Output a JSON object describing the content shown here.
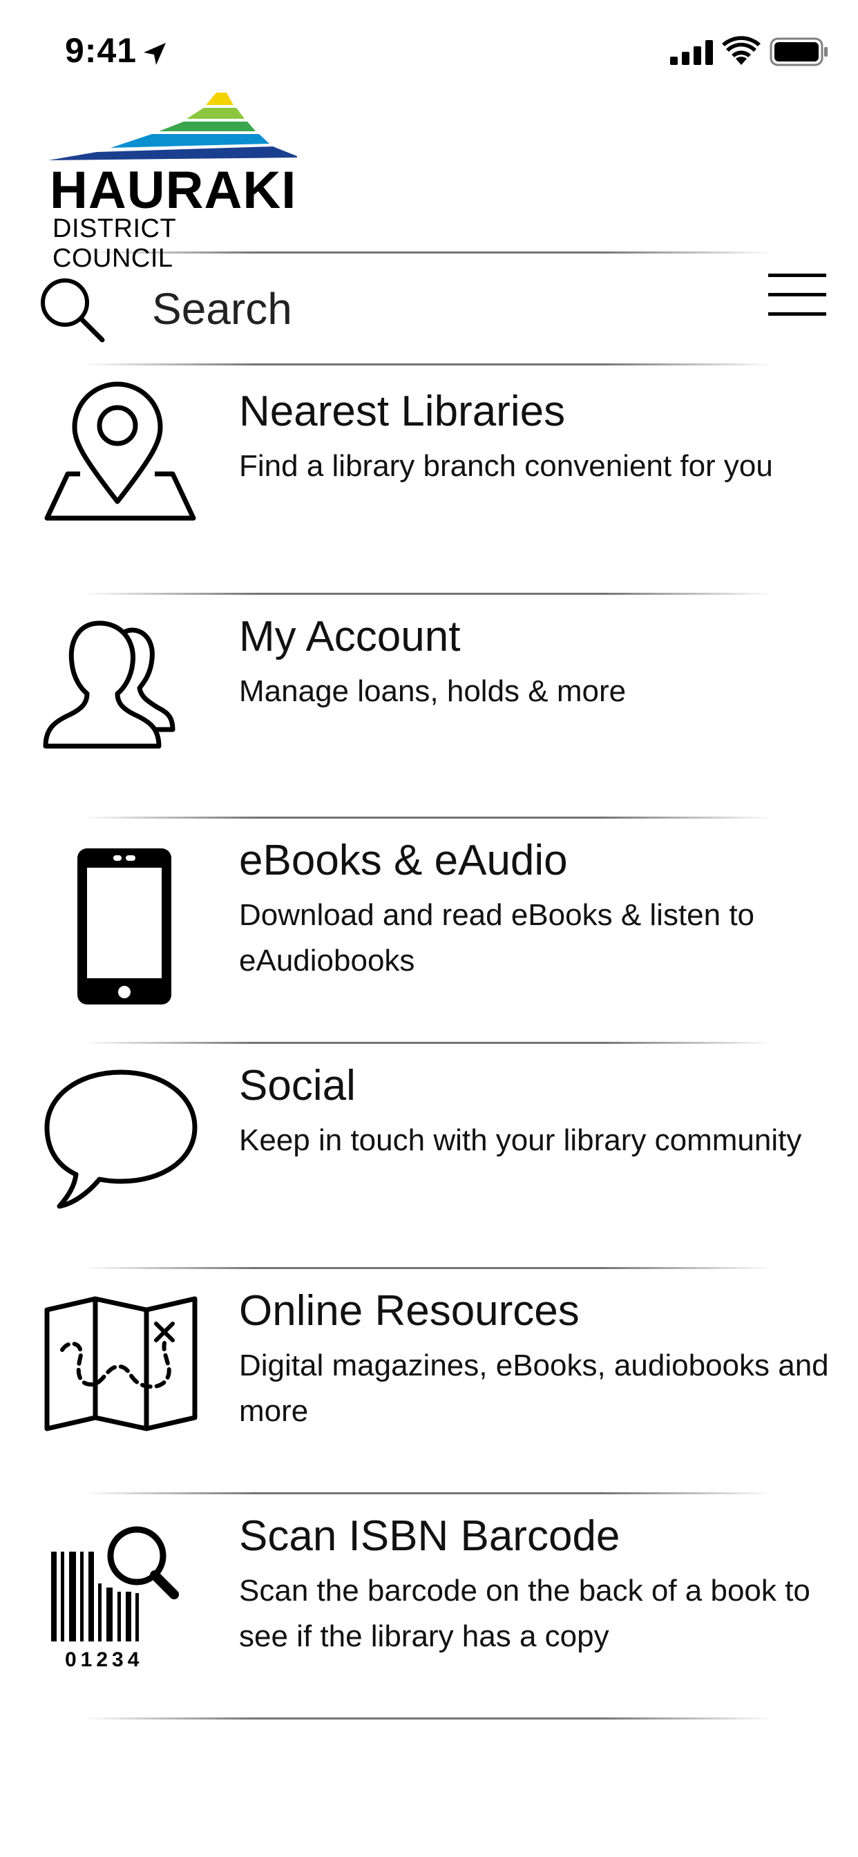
{
  "status_bar": {
    "time": "9:41",
    "icons": [
      "location-arrow-icon",
      "signal-icon",
      "wifi-icon",
      "battery-icon"
    ]
  },
  "logo": {
    "name": "HAURAKI",
    "subtitle": "DISTRICT COUNCIL",
    "colors": [
      "#f5d300",
      "#8cc63e",
      "#3aa54a",
      "#0a8fd0",
      "#1b3f8f"
    ]
  },
  "search": {
    "placeholder": "Search",
    "value": ""
  },
  "menu": {
    "items": [
      {
        "title": "Nearest Libraries",
        "description": "Find a library branch convenient for you",
        "icon": "map-pin-icon"
      },
      {
        "title": "My Account",
        "description": "Manage loans, holds & more",
        "icon": "users-icon"
      },
      {
        "title": "eBooks & eAudio",
        "description": "Download and read eBooks & listen to eAudiobooks",
        "icon": "phone-icon"
      },
      {
        "title": "Social",
        "description": "Keep in touch with your library community",
        "icon": "speech-bubble-icon"
      },
      {
        "title": "Online Resources",
        "description": "Digital magazines, eBooks, audiobooks and more",
        "icon": "treasure-map-icon"
      },
      {
        "title": "Scan ISBN Barcode",
        "description": "Scan the barcode on the back of a book to see if the library has a copy",
        "icon": "barcode-search-icon"
      }
    ],
    "barcode_digits": "01234"
  }
}
